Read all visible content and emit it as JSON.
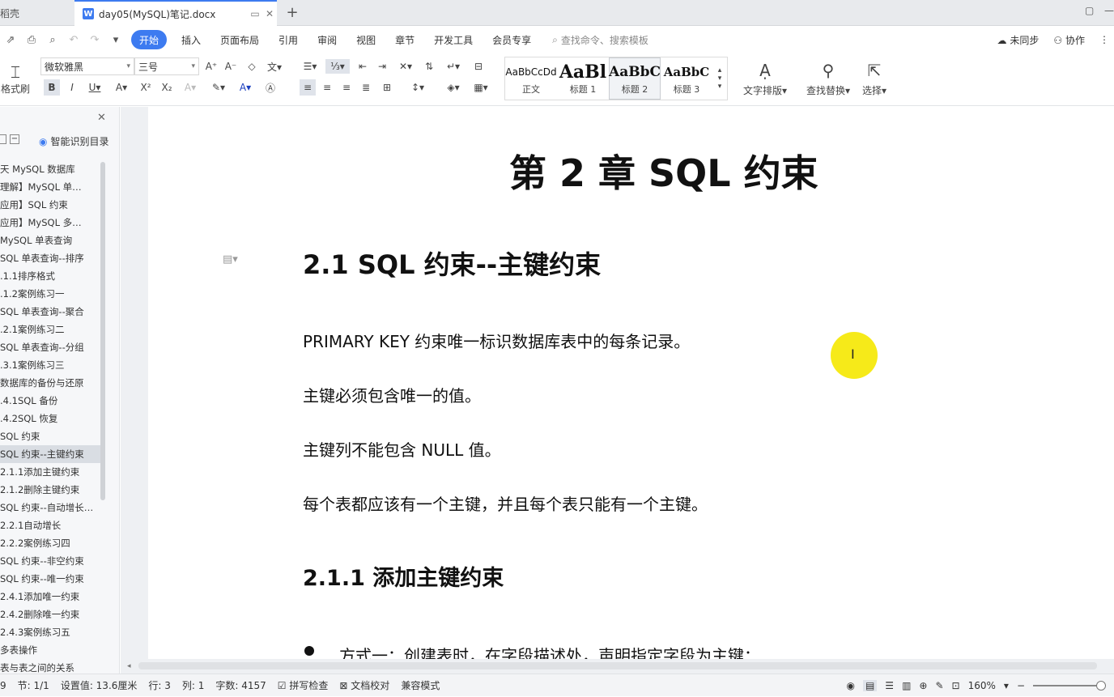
{
  "titlebar": {
    "prev_tab": "稻壳",
    "active_tab": "day05(MySQL)笔记.docx",
    "active_tab_icon": "W"
  },
  "menu": {
    "items": [
      "开始",
      "插入",
      "页面布局",
      "引用",
      "审阅",
      "视图",
      "章节",
      "开发工具",
      "会员专享"
    ],
    "search_placeholder": "查找命令、搜索模板",
    "sync": "未同步",
    "collab": "协作"
  },
  "ribbon": {
    "format_brush": "格式刷",
    "font_name": "微软雅黑",
    "font_size": "三号",
    "styles": [
      {
        "sample": "AaBbCcDd",
        "name": "正文"
      },
      {
        "sample": "AaBl",
        "name": "标题 1"
      },
      {
        "sample": "AaBbC",
        "name": "标题 2"
      },
      {
        "sample": "AaBbC",
        "name": "标题 3"
      }
    ],
    "text_layout": "文字排版",
    "find_replace": "查找替换",
    "select": "选择"
  },
  "nav": {
    "smart_toc": "智能识别目录",
    "items": [
      "天 MySQL 数据库",
      "理解】MySQL 单…",
      "应用】SQL 约束",
      "应用】MySQL 多…",
      "MySQL 单表查询",
      "SQL 单表查询--排序",
      ".1.1排序格式",
      ".1.2案例练习一",
      "SQL 单表查询--聚合",
      ".2.1案例练习二",
      "SQL 单表查询--分组",
      ".3.1案例练习三",
      "数据库的备份与还原",
      ".4.1SQL 备份",
      ".4.2SQL 恢复",
      "SQL 约束",
      "SQL 约束--主键约束",
      "2.1.1添加主键约束",
      "2.1.2删除主键约束",
      "SQL 约束--自动增长…",
      "2.2.1自动增长",
      "2.2.2案例练习四",
      "SQL 约束--非空约束",
      "SQL 约束--唯一约束",
      "2.4.1添加唯一约束",
      "2.4.2删除唯一约束",
      "2.4.3案例练习五",
      "多表操作",
      "表与表之间的关系"
    ],
    "current_index": 16
  },
  "document": {
    "chapter_title": "第 2 章   SQL 约束",
    "h1": "2.1 SQL 约束--主键约束",
    "paragraphs": [
      "PRIMARY KEY  约束唯一标识数据库表中的每条记录。",
      "主键必须包含唯一的值。",
      "主键列不能包含  NULL  值。",
      "每个表都应该有一个主键，并且每个表只能有一个主键。"
    ],
    "h2": "2.1.1 添加主键约束",
    "bullet": "方式一：创建表时，在字段描述处，声明指定字段为主键："
  },
  "status": {
    "page_num": "9",
    "section": "节: 1/1",
    "position": "设置值: 13.6厘米",
    "row": "行: 3",
    "col": "列: 1",
    "word_count": "字数: 4157",
    "spell_check": "拼写检查",
    "doc_proof": "文档校对",
    "compat": "兼容模式",
    "zoom": "160%"
  },
  "colors": {
    "accent": "#3d7bf0",
    "highlight": "#f5e800"
  }
}
